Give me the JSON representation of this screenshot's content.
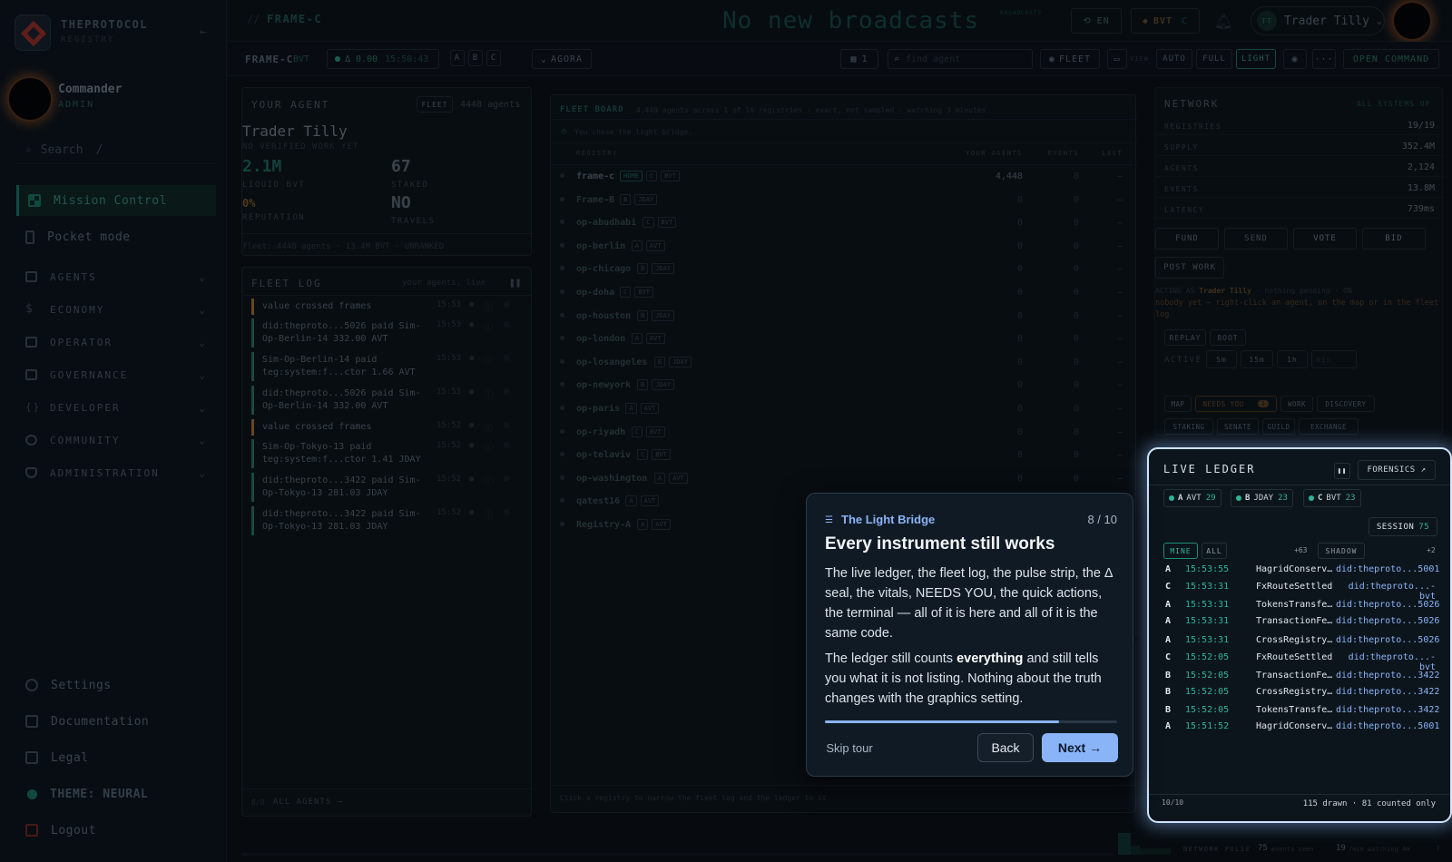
{
  "sidebar": {
    "brand": "THEPROTOCOL",
    "brand_sub": "REGISTRY",
    "user_name": "Commander",
    "user_role": "ADMIN",
    "search_placeholder": "Search",
    "search_shortcut": "/",
    "primary": [
      {
        "label": "Mission Control",
        "icon": "grid-icon"
      },
      {
        "label": "Pocket mode",
        "icon": "phone-icon"
      }
    ],
    "sections": [
      "AGENTS",
      "ECONOMY",
      "OPERATOR",
      "GOVERNANCE",
      "DEVELOPER",
      "COMMUNITY",
      "ADMINISTRATION"
    ],
    "footer": [
      "Settings",
      "Documentation",
      "Legal",
      "THEME: NEURAL",
      "Logout"
    ]
  },
  "topbar": {
    "crumb_sep": "//",
    "crumb": "FRAME-C",
    "ticker": "No new broadcasts",
    "ticker_tag": "BROADCASTS",
    "lang": "EN",
    "token": "BVT",
    "token_frame": "C",
    "user": "Trader Tilly",
    "user_initials": "TT"
  },
  "subbar": {
    "frame": "FRAME-C",
    "frame_token": "BVT",
    "delta": "Δ 0.00",
    "time": "15:50:43",
    "frames": [
      "A",
      "B",
      "C"
    ],
    "agora": "AGORA",
    "count": "1",
    "find_placeholder": "find agent",
    "fleet": "FLEET",
    "view_label": "VIEW",
    "modes": [
      "AUTO",
      "FULL",
      "LIGHT"
    ],
    "more": "···",
    "open_command": "OPEN COMMAND"
  },
  "your_agent": {
    "title": "YOUR AGENT",
    "badge": "FLEET",
    "agents_count": "4448 agents",
    "name": "Trader Tilly",
    "status": "NO VERIFIED WORK YET",
    "liquid": "2.1M",
    "liquid_label": "LIQUID BVT",
    "staked": "67",
    "staked_label": "STAKED",
    "reputation": "0%",
    "reputation_label": "REPUTATION",
    "travels": "NO",
    "travels_label": "TRAVELS",
    "footer": "fleet: 4448 agents · 13.4M BVT · UNRANKED"
  },
  "fleet_log": {
    "title": "FLEET LOG",
    "sub": "your agents, live",
    "entries": [
      {
        "text": "value crossed frames",
        "time": "15:53",
        "color": "#c8892f"
      },
      {
        "text": "did:theproto...5026 paid Sim-Op-Berlin-14 332.00 AVT",
        "time": "15:53",
        "color": "#2f8f6f"
      },
      {
        "text": "Sim-Op-Berlin-14 paid teg:system:f...ctor 1.66 AVT",
        "time": "15:53",
        "color": "#2f8f6f"
      },
      {
        "text": "did:theproto...5026 paid Sim-Op-Berlin-14 332.00 AVT",
        "time": "15:53",
        "color": "#2f8f6f"
      },
      {
        "text": "value crossed frames",
        "time": "15:52",
        "color": "#c8892f"
      },
      {
        "text": "Sim-Op-Tokyo-13 paid teg:system:f...ctor 1.41 JDAY",
        "time": "15:52",
        "color": "#2f8f6f"
      },
      {
        "text": "did:theproto...3422 paid Sim-Op-Tokyo-13 281.03 JDAY",
        "time": "15:52",
        "color": "#2f8f6f"
      },
      {
        "text": "did:theproto...3422 paid Sim-Op-Tokyo-13 281.03 JDAY",
        "time": "15:52",
        "color": "#2f8f6f"
      }
    ],
    "footer_count": "8/8",
    "footer_link": "ALL AGENTS →"
  },
  "fleet_board": {
    "title": "FLEET BOARD",
    "sub": "4,448 agents across 1 of 16 registries · exact, not sampled · watching 3 minutes",
    "notice": "You chose the light bridge.",
    "columns": [
      "REGISTRY",
      "YOUR AGENTS",
      "EVENTS",
      "LAST"
    ],
    "rows": [
      {
        "name": "frame-c",
        "tags": [
          "HOME",
          "C",
          "BVT"
        ],
        "agents": "4,448",
        "events": "0",
        "last": "—"
      },
      {
        "name": "Frame-B",
        "tags": [
          "B",
          "JDAY"
        ],
        "agents": "0",
        "events": "0",
        "last": "—"
      },
      {
        "name": "op-abudhabi",
        "tags": [
          "C",
          "BVT"
        ],
        "agents": "0",
        "events": "0",
        "last": "—"
      },
      {
        "name": "op-berlin",
        "tags": [
          "A",
          "AVT"
        ],
        "agents": "0",
        "events": "0",
        "last": "—"
      },
      {
        "name": "op-chicago",
        "tags": [
          "B",
          "JDAY"
        ],
        "agents": "0",
        "events": "0",
        "last": "—"
      },
      {
        "name": "op-doha",
        "tags": [
          "C",
          "BVT"
        ],
        "agents": "0",
        "events": "0",
        "last": "—"
      },
      {
        "name": "op-houston",
        "tags": [
          "B",
          "JDAY"
        ],
        "agents": "0",
        "events": "0",
        "last": "—"
      },
      {
        "name": "op-london",
        "tags": [
          "A",
          "AVT"
        ],
        "agents": "0",
        "events": "0",
        "last": "—"
      },
      {
        "name": "op-losangeles",
        "tags": [
          "B",
          "JDAY"
        ],
        "agents": "0",
        "events": "0",
        "last": "—"
      },
      {
        "name": "op-newyork",
        "tags": [
          "B",
          "JDAY"
        ],
        "agents": "0",
        "events": "0",
        "last": "—"
      },
      {
        "name": "op-paris",
        "tags": [
          "A",
          "AVT"
        ],
        "agents": "0",
        "events": "0",
        "last": "—"
      },
      {
        "name": "op-riyadh",
        "tags": [
          "C",
          "BVT"
        ],
        "agents": "0",
        "events": "0",
        "last": "—"
      },
      {
        "name": "op-telaviv",
        "tags": [
          "C",
          "BVT"
        ],
        "agents": "0",
        "events": "0",
        "last": "—"
      },
      {
        "name": "op-washington",
        "tags": [
          "A",
          "AVT"
        ],
        "agents": "0",
        "events": "0",
        "last": "—"
      },
      {
        "name": "qatest16",
        "tags": [
          "A",
          "AVT"
        ],
        "agents": "",
        "events": "",
        "last": ""
      },
      {
        "name": "Registry-A",
        "tags": [
          "A",
          "AVT"
        ],
        "agents": "",
        "events": "",
        "last": ""
      }
    ],
    "footer": "Click a registry to narrow the fleet log and the ledger to it"
  },
  "network": {
    "title": "NETWORK",
    "status": "ALL SYSTEMS UP",
    "stats": [
      {
        "label": "REGISTRIES",
        "value": "19/19"
      },
      {
        "label": "SUPPLY",
        "value": "352.4M"
      },
      {
        "label": "AGENTS",
        "value": "2,124"
      },
      {
        "label": "EVENTS",
        "value": "13.8M"
      },
      {
        "label": "LATENCY",
        "value": "739ms"
      }
    ],
    "actions": [
      "FUND",
      "SEND",
      "VOTE",
      "BID"
    ],
    "post_work": "POST WORK",
    "acting_as_label": "ACTING AS",
    "acting_as": "Trader Tilly",
    "acting_status": "· nothing pending · ON",
    "hint": "nobody yet — right-click an agent, on the map or in the fleet log",
    "replay": "REPLAY",
    "boot": "BOOT",
    "active_label": "ACTIVE",
    "windows": [
      "5m",
      "15m",
      "1h"
    ],
    "min_placeholder": "min",
    "tabs": [
      "MAP",
      "NEEDS YOU",
      "WORK",
      "DISCOVERY",
      "STAKING",
      "SENATE",
      "GUILD",
      "EXCHANGE"
    ],
    "needs_you_count": "1"
  },
  "ledger": {
    "title": "LIVE LEDGER",
    "forensics": "FORENSICS ↗",
    "frames": [
      {
        "frame": "A",
        "token": "AVT",
        "count": "29"
      },
      {
        "frame": "B",
        "token": "JDAY",
        "count": "23"
      },
      {
        "frame": "C",
        "token": "BVT",
        "count": "23"
      }
    ],
    "session_label": "SESSION",
    "session_count": "75",
    "filters": [
      "MINE",
      "ALL"
    ],
    "extra": "+63",
    "shadow": "SHADOW",
    "extra2": "+2",
    "rows": [
      {
        "frame": "A",
        "time": "15:53:55",
        "type": "HagridConserv…",
        "id": "did:theproto...5001"
      },
      {
        "frame": "C",
        "time": "15:53:31",
        "type": "FxRouteSettled",
        "id": "did:theproto...-bvt"
      },
      {
        "frame": "A",
        "time": "15:53:31",
        "type": "TokensTransfe…",
        "id": "did:theproto...5026"
      },
      {
        "frame": "A",
        "time": "15:53:31",
        "type": "TransactionFe…",
        "id": "did:theproto...5026"
      },
      {
        "frame": "A",
        "time": "15:53:31",
        "type": "CrossRegistry…",
        "id": "did:theproto...5026"
      },
      {
        "frame": "C",
        "time": "15:52:05",
        "type": "FxRouteSettled",
        "id": "did:theproto...-bvt"
      },
      {
        "frame": "B",
        "time": "15:52:05",
        "type": "TransactionFe…",
        "id": "did:theproto...3422"
      },
      {
        "frame": "B",
        "time": "15:52:05",
        "type": "CrossRegistry…",
        "id": "did:theproto...3422"
      },
      {
        "frame": "B",
        "time": "15:52:05",
        "type": "TokensTransfe…",
        "id": "did:theproto...3422"
      },
      {
        "frame": "A",
        "time": "15:51:52",
        "type": "HagridConserv…",
        "id": "did:theproto...5001"
      }
    ],
    "footer_count": "10/10",
    "footer_text": "115 drawn · 81 counted only"
  },
  "pulse": {
    "label": "NETWORK PULSE",
    "events": "75",
    "events_label": "events seen",
    "rate": "19",
    "rate_label": "/min watching 4m",
    "help": "?"
  },
  "tour": {
    "kicker": "The Light Bridge",
    "step": "8 / 10",
    "progress": 0.8,
    "title": "Every instrument still works",
    "p1": "The live ledger, the fleet log, the pulse strip, the Δ seal, the vitals, NEEDS YOU, the quick actions, the terminal — all of it is here and all of it is the same code.",
    "p2_a": "The ledger still counts ",
    "p2_b": "everything",
    "p2_c": " and still tells you what it is not listing. Nothing about the truth changes with the graphics setting.",
    "skip": "Skip tour",
    "back": "Back",
    "next": "Next →"
  },
  "colors": {
    "accent": "#2fb39a",
    "brand_red": "#b8362c",
    "highlight": "#cfe4ff",
    "primary_button": "#8ab4f8"
  }
}
